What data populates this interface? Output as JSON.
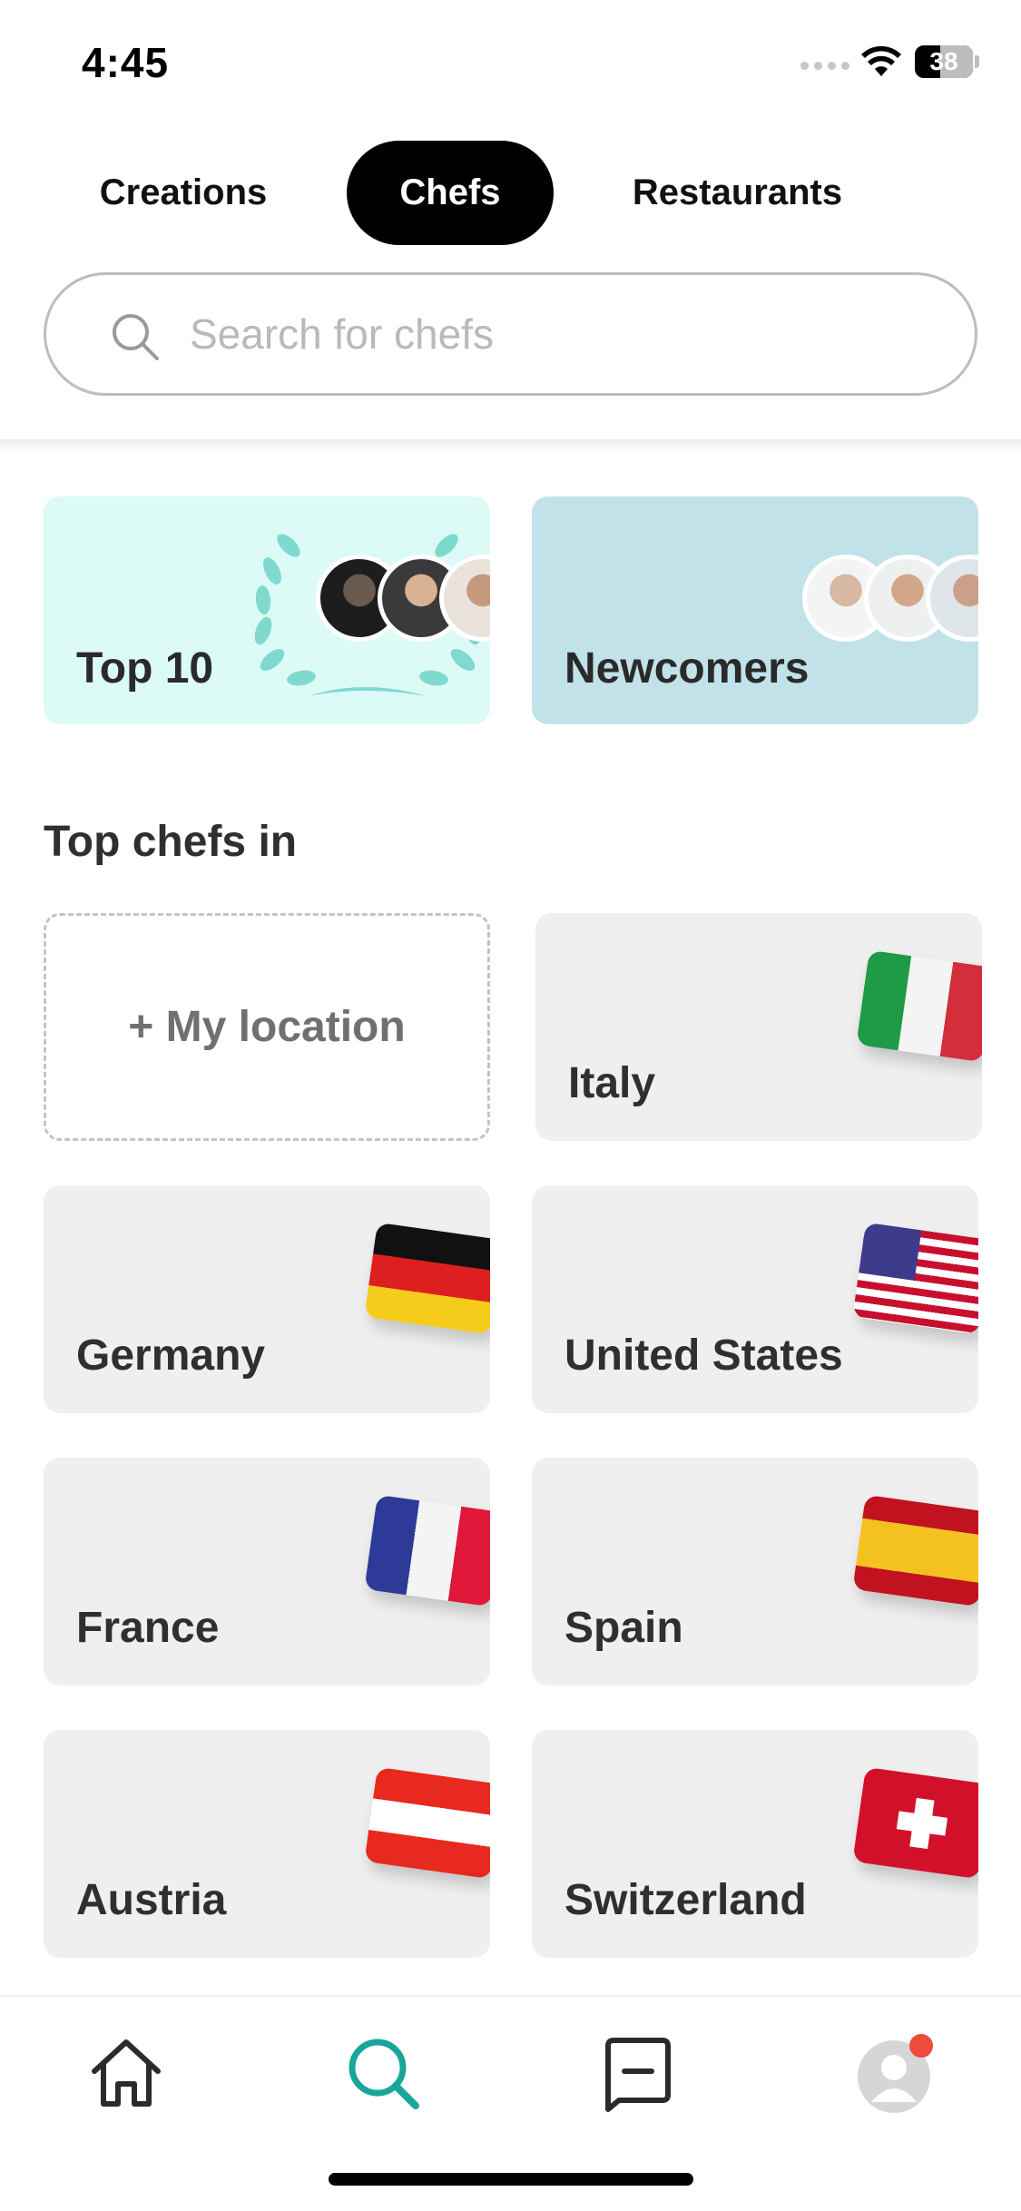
{
  "status_bar": {
    "time": "4:45",
    "battery_level": "38"
  },
  "tabs": [
    {
      "label": "Creations",
      "active": false
    },
    {
      "label": "Chefs",
      "active": true
    },
    {
      "label": "Restaurants",
      "active": false
    }
  ],
  "search": {
    "placeholder": "Search for chefs",
    "value": ""
  },
  "features": {
    "top10": {
      "label": "Top 10",
      "color": "#dcfaf6"
    },
    "newcomers": {
      "label": "Newcomers",
      "color": "#c2e2e9"
    }
  },
  "section": {
    "title": "Top chefs in"
  },
  "locations": {
    "my_location": "+ My location",
    "countries": [
      {
        "label": "Italy",
        "flag": "italy-flag"
      },
      {
        "label": "Germany",
        "flag": "germany-flag"
      },
      {
        "label": "United States",
        "flag": "usa-flag"
      },
      {
        "label": "France",
        "flag": "france-flag"
      },
      {
        "label": "Spain",
        "flag": "spain-flag"
      },
      {
        "label": "Austria",
        "flag": "austria-flag"
      },
      {
        "label": "Switzerland",
        "flag": "switzerland-flag"
      }
    ]
  },
  "bottom_nav": {
    "items": [
      {
        "icon": "home-icon",
        "active": false
      },
      {
        "icon": "search-icon",
        "active": true
      },
      {
        "icon": "messages-icon",
        "active": false
      },
      {
        "icon": "profile-icon",
        "active": false,
        "badge": true
      }
    ],
    "accent_color": "#1aa59a",
    "badge_color": "#ee4b3b"
  }
}
